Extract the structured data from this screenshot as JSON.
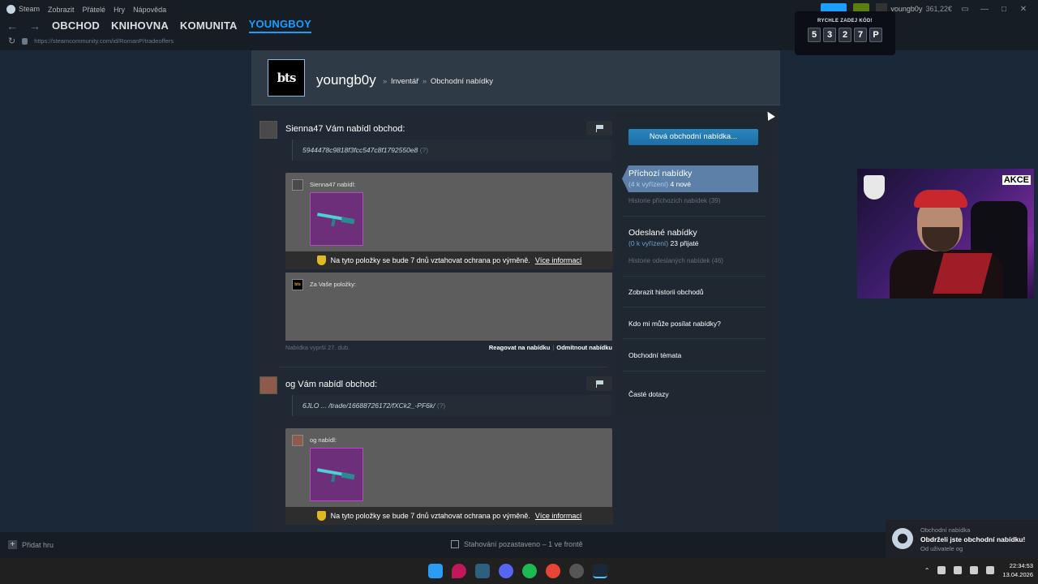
{
  "client": {
    "menu": [
      "Steam",
      "Zobrazit",
      "Přátelé",
      "Hry",
      "Nápověda"
    ],
    "nav": [
      "OBCHOD",
      "KNIHOVNA",
      "KOMUNITA",
      "YOUNGBOY"
    ],
    "url": "https://steamcommunity.com/id/RomanP/tradeoffers",
    "account_name": "youngb0y",
    "balance": "361,22€"
  },
  "code_overlay": {
    "title": "RYCHLE ZADEJ KÓD!",
    "chars": [
      "5",
      "3",
      "2",
      "7",
      "P"
    ]
  },
  "profile": {
    "logo": "bts",
    "name": "youngb0y",
    "crumb_inventory": "Inventář",
    "crumb_offers": "Obchodní nabídky"
  },
  "offers": [
    {
      "title": "Sienna47 Vám nabídl obchod:",
      "message": "5944478c9818f3fcc547c8f1792550e8",
      "question": "(?)",
      "offered_label": "Sienna47 nabídl:",
      "protection": "Na tyto položky se bude 7 dnů vztahovat ochrana po výměně.",
      "more_info": "Více informací",
      "your_items_label": "Za Vaše položky:",
      "expires": "Nabídka vyprší 27. dub.",
      "respond": "Reagovat na nabídku",
      "decline": "Odmítnout nabídku"
    },
    {
      "title": "og Vám nabídl obchod:",
      "message": "6JLO ... /trade/16688726172/fXCk2_-PF6k/",
      "question": "(?)",
      "offered_label": "og nabídl:",
      "protection": "Na tyto položky se bude 7 dnů vztahovat ochrana po výměně.",
      "more_info": "Více informací"
    }
  ],
  "sidebar": {
    "new_offer": "Nová obchodní nabídka...",
    "incoming_title": "Příchozí nabídky",
    "incoming_pending": "(4 k vyřízení)",
    "incoming_new": "4 nové",
    "incoming_history": "Historie příchozích nabídek (39)",
    "sent_title": "Odeslané nabídky",
    "sent_pending": "(0 k vyřízení)",
    "sent_accepted": "23 přijaté",
    "sent_history": "Historie odeslaných nabídek (46)",
    "trade_history": "Zobrazit historii obchodů",
    "who_can_send": "Kdo mi může posílat nabídky?",
    "trade_topics": "Obchodní témata",
    "faq": "Časté dotazy"
  },
  "webcam": {
    "badge": "AKCE"
  },
  "statusbar": {
    "add_game": "Přidat hru",
    "download": "Stahování pozastaveno – 1 ve frontě"
  },
  "toast": {
    "tag": "Obchodní nabídka",
    "message": "Obdrželi jste obchodní nabídku!",
    "from": "Od uživatele og"
  },
  "taskbar": {
    "time": "22:34:53",
    "date": "13.04.2026"
  }
}
